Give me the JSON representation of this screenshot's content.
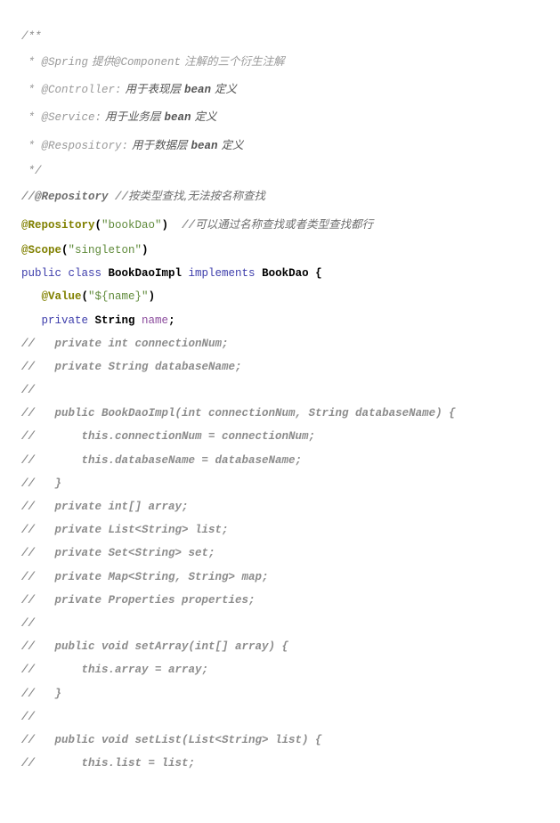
{
  "lines": {
    "l1": "/**",
    "l2_star": " * ",
    "l2_ann": "@Spring",
    "l2_text": " 提供",
    "l2_ann2": "@Component",
    "l2_text2": " 注解的三个衍生注解",
    "l3_star": " * ",
    "l3_ann": "@Controller:",
    "l3_text": " 用于表现层 ",
    "l3_bean": "bean",
    "l3_text2": " 定义",
    "l4_star": " * ",
    "l4_ann": "@Service:",
    "l4_text": " 用于业务层 ",
    "l4_bean": "bean",
    "l4_text2": " 定义",
    "l5_star": " * ",
    "l5_ann": "@Respository:",
    "l5_text": " 用于数据层 ",
    "l5_bean": "bean",
    "l5_text2": " 定义",
    "l6": " */",
    "l7_a": "//",
    "l7_b": "@Repository",
    "l7_c": " //",
    "l7_d": "按类型查找,无法按名称查找",
    "l8_ann": "@Repository",
    "l8_p1": "(",
    "l8_str": "\"bookDao\"",
    "l8_p2": ")",
    "l8_c": "  //",
    "l8_ct": "可以通过名称查找或者类型查找都行",
    "l9_ann": "@Scope",
    "l9_p1": "(",
    "l9_str": "\"singleton\"",
    "l9_p2": ")",
    "l10_kw": "public class ",
    "l10_cls": "BookDaoImpl",
    "l10_kw2": " implements ",
    "l10_cls2": "BookDao",
    "l10_p": " {",
    "l11_ind": "   ",
    "l11_ann": "@Value",
    "l11_p1": "(",
    "l11_str": "\"${name}\"",
    "l11_p2": ")",
    "l12_ind": "   ",
    "l12_kw": "private ",
    "l12_cls": "String",
    "l12_fld": " name",
    "l12_p": ";",
    "l13": "//   private int connectionNum;",
    "l14": "//   private String databaseName;",
    "l15": "//",
    "l16": "//   public BookDaoImpl(int connectionNum, String databaseName) {",
    "l17": "//       this.connectionNum = connectionNum;",
    "l18": "//       this.databaseName = databaseName;",
    "l19": "//   }",
    "l20": "//   private int[] array;",
    "l21": "//   private List<String> list;",
    "l22": "//   private Set<String> set;",
    "l23": "//   private Map<String, String> map;",
    "l24": "//   private Properties properties;",
    "l25": "//",
    "l26": "//   public void setArray(int[] array) {",
    "l27": "//       this.array = array;",
    "l28": "//   }",
    "l29": "//",
    "l30": "//   public void setList(List<String> list) {",
    "l31": "//       this.list = list;"
  }
}
